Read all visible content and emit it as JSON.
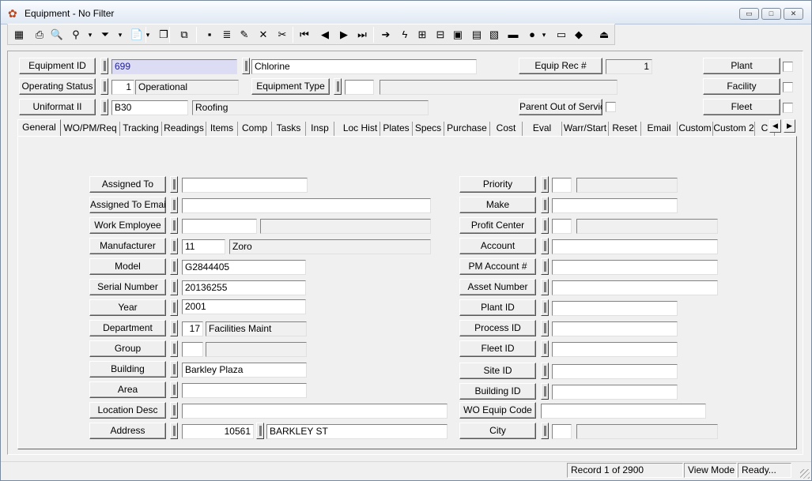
{
  "window": {
    "title": "Equipment - No Filter",
    "minimize_label": "▭",
    "maximize_label": "□",
    "close_label": "✕"
  },
  "toolbar": {
    "icons": [
      {
        "name": "grid-icon",
        "glyph": "▦"
      },
      {
        "name": "print-icon",
        "glyph": "⎙"
      },
      {
        "name": "preview-icon",
        "glyph": "🔍"
      },
      {
        "name": "binoculars-icon",
        "glyph": "⚲"
      },
      {
        "name": "binoculars-dropdown-icon",
        "glyph": "▾"
      },
      {
        "name": "filter-icon",
        "glyph": "⏷"
      },
      {
        "name": "filter-dropdown-icon",
        "glyph": "▾"
      },
      {
        "name": "report-icon",
        "glyph": "📄"
      },
      {
        "name": "report-dropdown-icon",
        "glyph": "▾"
      },
      {
        "name": "copy-record-icon",
        "glyph": "❐"
      },
      {
        "name": "duplicate-icon",
        "glyph": "⧉"
      },
      {
        "name": "save-icon",
        "glyph": "▪"
      },
      {
        "name": "stack-icon",
        "glyph": "≣"
      },
      {
        "name": "edit-pencil-icon",
        "glyph": "✎"
      },
      {
        "name": "delete-icon",
        "glyph": "✕"
      },
      {
        "name": "cut-icon",
        "glyph": "✂"
      },
      {
        "name": "first-record-icon",
        "glyph": "⏮"
      },
      {
        "name": "previous-record-icon",
        "glyph": "◀"
      },
      {
        "name": "next-record-icon",
        "glyph": "▶"
      },
      {
        "name": "last-record-icon",
        "glyph": "⏭"
      },
      {
        "name": "goto-arrow-icon",
        "glyph": "➔"
      },
      {
        "name": "lightning-icon",
        "glyph": "ϟ"
      },
      {
        "name": "org-chart-icon",
        "glyph": "⊞"
      },
      {
        "name": "hierarchy-icon",
        "glyph": "⊟"
      },
      {
        "name": "picture-icon",
        "glyph": "▣"
      },
      {
        "name": "calculator-icon",
        "glyph": "▤"
      },
      {
        "name": "map-icon",
        "glyph": "▧"
      },
      {
        "name": "truck-icon",
        "glyph": "▬"
      },
      {
        "name": "globe-icon",
        "glyph": "●"
      },
      {
        "name": "globe-dropdown-icon",
        "glyph": "▾"
      },
      {
        "name": "screen-icon",
        "glyph": "▭"
      },
      {
        "name": "book-icon",
        "glyph": "◆"
      },
      {
        "name": "exit-icon",
        "glyph": "⏏"
      }
    ]
  },
  "header": {
    "equipment_id_label": "Equipment ID",
    "equipment_id_value": "699",
    "equipment_desc_value": "Chlorine",
    "equip_rec_label": "Equip Rec #",
    "equip_rec_value": "1",
    "plant_label": "Plant",
    "operating_status_label": "Operating Status",
    "operating_status_code": "1",
    "operating_status_desc": "Operational",
    "equipment_type_label": "Equipment Type",
    "equipment_type_code": "",
    "equipment_type_desc": "",
    "facility_label": "Facility",
    "uniformat_label": "Uniformat II",
    "uniformat_code": "B30",
    "uniformat_desc": "Roofing",
    "parent_oos_label": "Parent Out of Service",
    "fleet_label": "Fleet"
  },
  "tabs": [
    "General",
    "WO/PM/Req",
    "Tracking",
    "Readings",
    "Items",
    "Comp",
    "Tasks",
    "Insp",
    "Loc Hist",
    "Plates",
    "Specs",
    "Purchase",
    "Cost",
    "Eval",
    "Warr/Start",
    "Reset",
    "Email",
    "Custom",
    "Custom 2",
    "C"
  ],
  "tab_nav": {
    "prev": "◀",
    "next": "▶"
  },
  "general": {
    "left": {
      "assigned_to": {
        "label": "Assigned To",
        "value": ""
      },
      "assigned_to_email": {
        "label": "Assigned To Email",
        "value": ""
      },
      "work_employee": {
        "label": "Work Employee",
        "value": "",
        "desc": ""
      },
      "manufacturer": {
        "label": "Manufacturer",
        "code": "11",
        "desc": "Zoro"
      },
      "model": {
        "label": "Model",
        "value": "G2844405"
      },
      "serial_number": {
        "label": "Serial Number",
        "value": "20136255"
      },
      "year": {
        "label": "Year",
        "value": "2001"
      },
      "department": {
        "label": "Department",
        "code": "17",
        "desc": "Facilities Maint"
      },
      "group": {
        "label": "Group",
        "code": "",
        "desc": ""
      },
      "building": {
        "label": "Building",
        "value": "Barkley Plaza"
      },
      "area": {
        "label": "Area",
        "value": ""
      },
      "location_desc": {
        "label": "Location Desc",
        "value": ""
      },
      "address": {
        "label": "Address",
        "number": "10561",
        "street": "BARKLEY ST"
      }
    },
    "right": {
      "priority": {
        "label": "Priority",
        "code": "",
        "desc": ""
      },
      "make": {
        "label": "Make",
        "value": ""
      },
      "profit_center": {
        "label": "Profit Center",
        "code": "",
        "desc": ""
      },
      "account": {
        "label": "Account",
        "value": ""
      },
      "pm_account": {
        "label": "PM Account #",
        "value": ""
      },
      "asset_number": {
        "label": "Asset Number",
        "value": ""
      },
      "plant_id": {
        "label": "Plant ID",
        "value": ""
      },
      "process_id": {
        "label": "Process ID",
        "value": ""
      },
      "fleet_id": {
        "label": "Fleet ID",
        "value": ""
      },
      "site_id": {
        "label": "Site ID",
        "value": ""
      },
      "building_id": {
        "label": "Building ID",
        "value": ""
      },
      "wo_equip_code": {
        "label": "WO Equip Code",
        "value": ""
      },
      "city": {
        "label": "City",
        "code": "",
        "desc": ""
      }
    }
  },
  "status": {
    "record": "Record 1 of 2900",
    "mode": "View Mode",
    "state": "Ready..."
  }
}
